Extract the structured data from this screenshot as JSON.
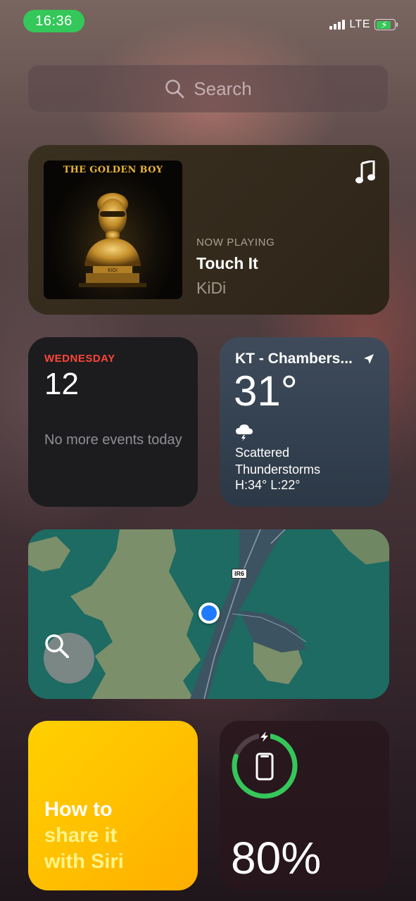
{
  "status_bar": {
    "time": "16:36",
    "network": "LTE",
    "colors": {
      "time_pill": "#34c759",
      "battery_fill": "#34c759"
    }
  },
  "search": {
    "placeholder": "Search",
    "icon": "search-icon"
  },
  "music_widget": {
    "album_title": "THE GOLDEN BOY",
    "album_artist_badge": "KiDi",
    "status_label": "NOW PLAYING",
    "song": "Touch It",
    "artist": "KiDi",
    "icon": "music-note-icon"
  },
  "calendar_widget": {
    "day": "WEDNESDAY",
    "date": "12",
    "events_text": "No more events today",
    "accent": "#ff453a"
  },
  "weather_widget": {
    "location": "KT - Chambers...",
    "temperature": "31°",
    "condition_line1": "Scattered",
    "condition_line2": "Thunderstorms",
    "high_low": "H:34° L:22°",
    "icon": "thunderstorm-cloud-icon"
  },
  "map_widget": {
    "road_label": "IR6",
    "search_icon": "search-icon"
  },
  "siri_widget": {
    "line1": "How to",
    "line2": "share it",
    "line3": "with Siri"
  },
  "battery_widget": {
    "percent_text": "80%",
    "level_fraction": 0.8,
    "charging": true,
    "ring_color": "#34c759",
    "icon": "iphone-icon"
  }
}
